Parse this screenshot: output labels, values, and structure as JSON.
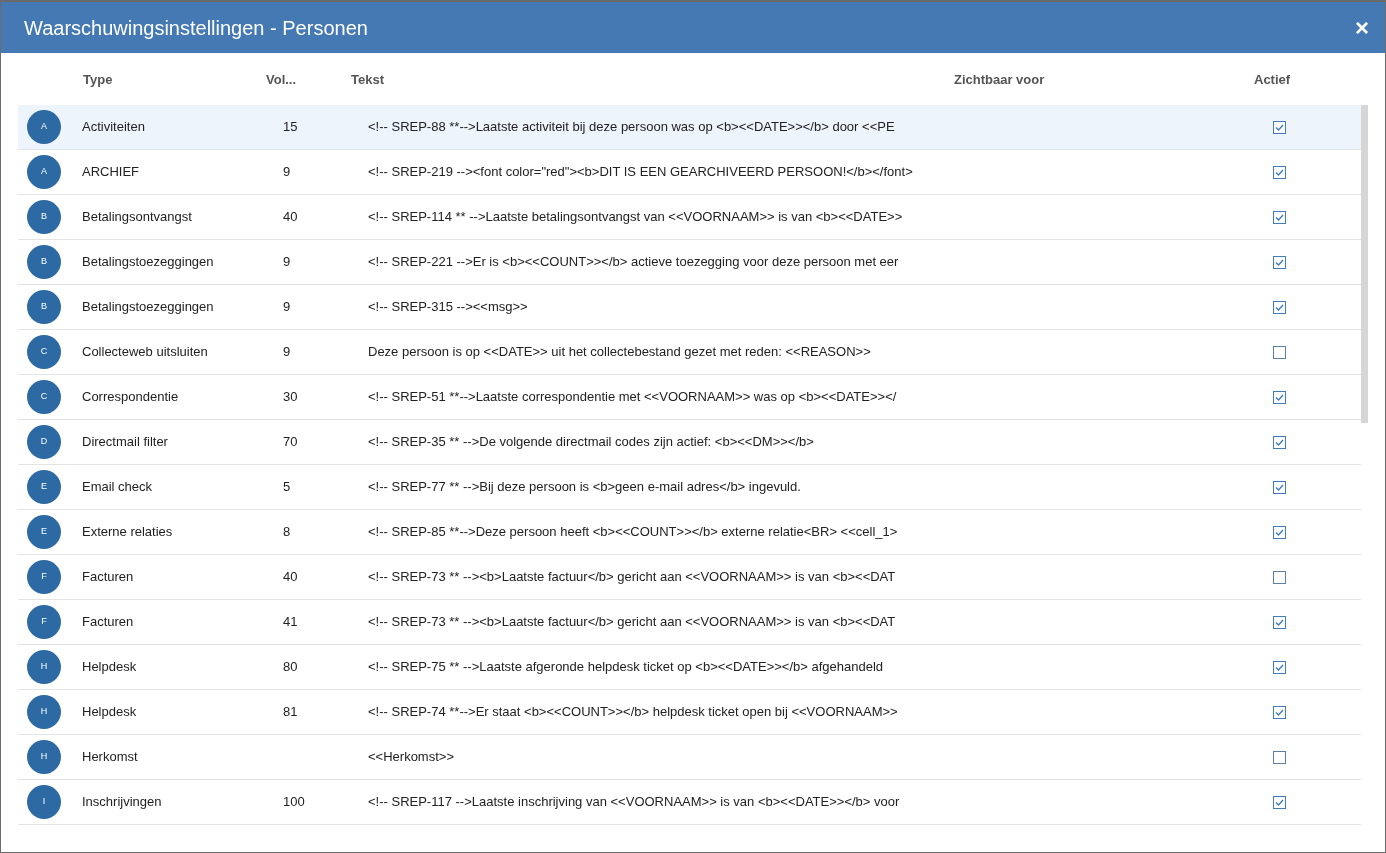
{
  "window": {
    "title": "Waarschuwingsinstellingen - Personen",
    "close": "×"
  },
  "table": {
    "columns": [
      "Type",
      "Vol...",
      "Tekst",
      "Zichtbaar voor",
      "Actief"
    ],
    "rows": [
      {
        "letter": "A",
        "type": "Activiteiten",
        "vol": "15",
        "tekst": "<!-- SREP-88 **-->Laatste activiteit bij deze persoon was op <b><<DATE>></b> door <<PE",
        "active": true,
        "selected": true
      },
      {
        "letter": "A",
        "type": "ARCHIEF",
        "vol": "9",
        "tekst": "<!-- SREP-219 --><font color=\"red\"><b>DIT IS EEN GEARCHIVEERD PERSOON!</b></font>",
        "active": true,
        "selected": false
      },
      {
        "letter": "B",
        "type": "Betalingsontvangst",
        "vol": "40",
        "tekst": "<!-- SREP-114 ** -->Laatste betalingsontvangst van <<VOORNAAM>> is van <b><<DATE>>",
        "active": true,
        "selected": false
      },
      {
        "letter": "B",
        "type": "Betalingstoezeggingen",
        "vol": "9",
        "tekst": "<!-- SREP-221 -->Er is <b><<COUNT>></b> actieve toezegging voor deze persoon met eer",
        "active": true,
        "selected": false
      },
      {
        "letter": "B",
        "type": "Betalingstoezeggingen",
        "vol": "9",
        "tekst": "<!-- SREP-315 --><<msg>>",
        "active": true,
        "selected": false
      },
      {
        "letter": "C",
        "type": "Collecteweb uitsluiten",
        "vol": "9",
        "tekst": "Deze persoon is op <<DATE>> uit het collectebestand gezet met reden: <<REASON>>",
        "active": false,
        "selected": false
      },
      {
        "letter": "C",
        "type": "Correspondentie",
        "vol": "30",
        "tekst": "<!-- SREP-51 **-->Laatste correspondentie met <<VOORNAAM>> was op <b><<DATE>></",
        "active": true,
        "selected": false
      },
      {
        "letter": "D",
        "type": "Directmail filter",
        "vol": "70",
        "tekst": "<!-- SREP-35 ** -->De volgende directmail codes zijn actief: <b><<DM>></b>",
        "active": true,
        "selected": false
      },
      {
        "letter": "E",
        "type": "Email check",
        "vol": "5",
        "tekst": "<!-- SREP-77 ** -->Bij deze persoon is <b>geen e-mail adres</b> ingevuld.",
        "active": true,
        "selected": false
      },
      {
        "letter": "E",
        "type": "Externe relaties",
        "vol": "8",
        "tekst": "<!-- SREP-85 **-->Deze persoon heeft <b><<COUNT>></b> externe relatie<BR> <<cell_1>",
        "active": true,
        "selected": false
      },
      {
        "letter": "F",
        "type": "Facturen",
        "vol": "40",
        "tekst": "<!-- SREP-73 ** --><b>Laatste factuur</b> gericht aan <<VOORNAAM>> is van <b><<DAT",
        "active": false,
        "selected": false
      },
      {
        "letter": "F",
        "type": "Facturen",
        "vol": "41",
        "tekst": "<!-- SREP-73 ** --><b>Laatste factuur</b> gericht aan <<VOORNAAM>> is van <b><<DAT",
        "active": true,
        "selected": false
      },
      {
        "letter": "H",
        "type": "Helpdesk",
        "vol": "80",
        "tekst": "<!-- SREP-75 ** -->Laatste afgeronde helpdesk ticket op <b><<DATE>></b> afgehandeld",
        "active": true,
        "selected": false
      },
      {
        "letter": "H",
        "type": "Helpdesk",
        "vol": "81",
        "tekst": "<!-- SREP-74 **-->Er staat <b><<COUNT>></b> helpdesk ticket open bij <<VOORNAAM>>",
        "active": true,
        "selected": false
      },
      {
        "letter": "H",
        "type": "Herkomst",
        "tekst": "<<Herkomst>>",
        "active": false,
        "selected": false
      },
      {
        "letter": "I",
        "type": "Inschrijvingen",
        "vol": "100",
        "tekst": "<!-- SREP-117 -->Laatste inschrijving van <<VOORNAAM>> is van <b><<DATE>></b> voor",
        "active": true,
        "selected": false
      }
    ]
  }
}
